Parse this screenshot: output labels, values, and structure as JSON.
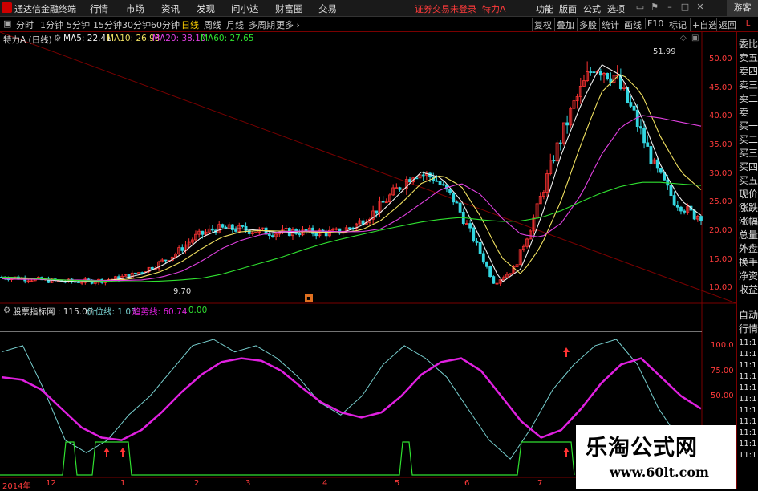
{
  "app": {
    "name": "通达信金融终端",
    "warning": "证券交易未登录",
    "stock_title": "特力A",
    "guest": "游客"
  },
  "menu": [
    "行情",
    "市场",
    "资讯",
    "发现",
    "问小达",
    "财富圈",
    "交易"
  ],
  "right_menu": [
    "功能",
    "版面",
    "公式",
    "选项"
  ],
  "periods": [
    "分时",
    "1分钟",
    "5分钟",
    "15分钟",
    "30分钟",
    "60分钟",
    "日线",
    "周线",
    "月线",
    "多周期",
    "更多"
  ],
  "active_period": "日线",
  "tools": [
    "复权",
    "叠加",
    "多股",
    "统计",
    "画线",
    "F10",
    "标记",
    "+自选",
    "返回"
  ],
  "ma": {
    "name": "特力A (日线)",
    "ma5": "MA5: 22.41",
    "ma10": "MA10: 26.93",
    "ma20": "MA20: 38.10",
    "ma60": "MA60: 27.65"
  },
  "indicator": {
    "name": "股票指标网 : 115.00",
    "l1": "价位线: 1.05",
    "l2": "趋势线: 60.74",
    "l3": ": 0.00"
  },
  "price_axis": [
    "50.00",
    "45.00",
    "40.00",
    "35.00",
    "30.00",
    "25.00",
    "20.00",
    "15.00",
    "10.00"
  ],
  "indi_axis": [
    "100.0",
    "75.00",
    "50.00"
  ],
  "annotations": {
    "high": "51.99",
    "low": "9.70"
  },
  "dates": [
    "2014年",
    "12",
    "1",
    "2",
    "3",
    "4",
    "5",
    "6",
    "7"
  ],
  "right_panel": {
    "top": "L",
    "items": [
      "委比",
      "卖五",
      "卖四",
      "卖三",
      "卖二",
      "卖一",
      "买一",
      "买二",
      "买三",
      "买四",
      "买五",
      "现价",
      "涨跌",
      "涨幅",
      "总量",
      "外盘",
      "换手",
      "净资",
      "收益"
    ],
    "sub_header": [
      "自动",
      "行情"
    ],
    "times": [
      "11:1",
      "11:1",
      "11:1",
      "11:1",
      "11:1",
      "11:1",
      "11:1",
      "11:1",
      "11:1",
      "11:1",
      "11:1"
    ]
  },
  "watermark": {
    "title": "乐淘公式网",
    "url": "www.60lt.com"
  },
  "colors": {
    "bull": "#ff3333",
    "bear": "#33d6e0",
    "ma5": "#f0f0f0",
    "ma10": "#f0e060",
    "ma20": "#e040e0",
    "ma60": "#30e030",
    "trend": "#e020e0",
    "price_line": "#78d0d0"
  },
  "chart_data": {
    "type": "line",
    "title": "",
    "ylim": [
      9,
      53
    ],
    "series": [
      {
        "name": "MA5",
        "values": [
          11.5,
          11.4,
          11.1,
          10.8,
          10.7,
          10.8,
          11.2,
          12,
          13.5,
          15.5,
          18.5,
          20,
          20,
          19.7,
          19.3,
          19.5,
          19.4,
          19.3,
          20.5,
          23,
          26.5,
          30,
          29,
          25,
          18,
          10.5,
          13,
          22,
          33,
          42,
          49,
          47,
          40,
          31,
          25,
          22.4
        ]
      },
      {
        "name": "MA10",
        "values": [
          11.3,
          11.3,
          11.2,
          11,
          10.9,
          10.9,
          11,
          11.5,
          12.5,
          14.2,
          16.5,
          18.5,
          19.5,
          19.7,
          19.6,
          19.5,
          19.4,
          19.3,
          19.8,
          21.5,
          24.5,
          28,
          29.5,
          27.5,
          22,
          15,
          12,
          17,
          25,
          35,
          44,
          47.5,
          44,
          36,
          30,
          26.9
        ]
      },
      {
        "name": "MA20",
        "values": [
          11.2,
          11.1,
          11.1,
          11,
          11,
          10.9,
          10.9,
          11,
          11.5,
          12.5,
          14.3,
          16.5,
          18,
          19,
          19.5,
          19.6,
          19.6,
          19.5,
          19.5,
          20,
          22,
          24.5,
          27,
          28,
          26,
          22,
          19,
          18.5,
          21,
          26,
          33,
          38,
          40,
          39.5,
          38.8,
          38.1
        ]
      },
      {
        "name": "MA60",
        "values": [
          11.5,
          11.4,
          11.2,
          11,
          10.9,
          10.8,
          10.7,
          10.7,
          10.8,
          11,
          11.3,
          12,
          13,
          14,
          15,
          16.2,
          17.3,
          18.2,
          19,
          19.8,
          20.5,
          21.2,
          21.7,
          22,
          21.6,
          21.3,
          21.4,
          22,
          23.2,
          24.8,
          26.3,
          27.5,
          28.2,
          28.2,
          27.9,
          27.65
        ]
      }
    ]
  }
}
